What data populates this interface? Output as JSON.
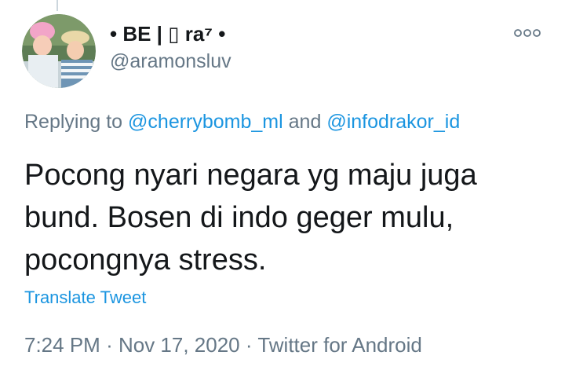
{
  "tweet": {
    "author": {
      "display_name": "• BE | ▯ ra⁷ •",
      "handle": "@aramonsluv"
    },
    "reply_to": {
      "prefix": "Replying to",
      "mention_1": "@cherrybomb_ml",
      "conjunction": "and",
      "mention_2": "@infodrakor_id"
    },
    "text": "Pocong nyari negara yg maju juga bund. Bosen di indo geger mulu, pocongnya stress.",
    "translate_label": "Translate Tweet",
    "time": "7:24 PM",
    "separator": "·",
    "date": "Nov 17, 2020",
    "source": "Twitter for Android"
  },
  "icons": {
    "more": "more-options-icon",
    "avatar": "profile-photo"
  },
  "colors": {
    "link": "#1b95e0",
    "secondary_text": "#657786",
    "primary_text": "#14171a",
    "thread_line": "#ccd6dd"
  }
}
